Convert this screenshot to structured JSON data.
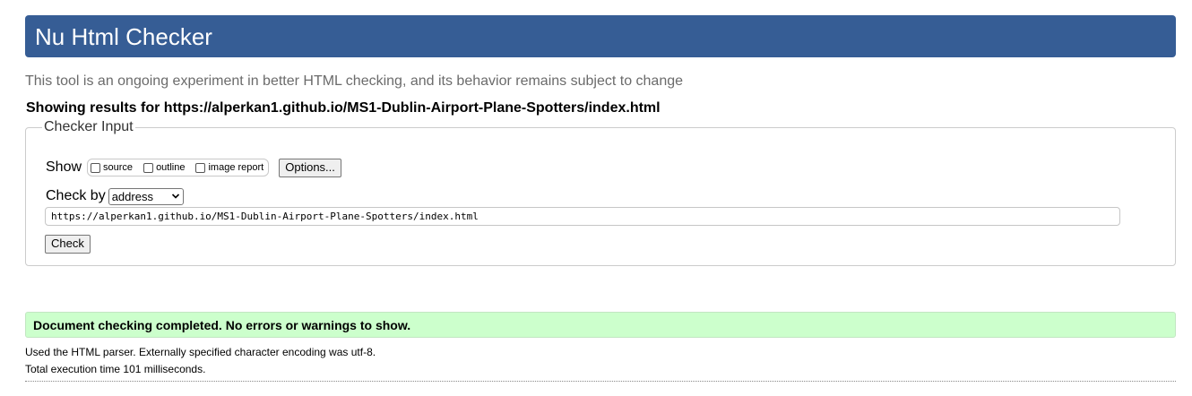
{
  "header": {
    "title": "Nu Html Checker"
  },
  "intro": "This tool is an ongoing experiment in better HTML checking, and its behavior remains subject to change",
  "results_for": "Showing results for https://alperkan1.github.io/MS1-Dublin-Airport-Plane-Spotters/index.html",
  "checker_input": {
    "legend": "Checker Input",
    "show_label": "Show",
    "show_options": [
      {
        "label": "source",
        "checked": false
      },
      {
        "label": "outline",
        "checked": false
      },
      {
        "label": "image report",
        "checked": false
      }
    ],
    "options_button": "Options...",
    "check_by_label": "Check by",
    "check_by_value": "address",
    "url_value": "https://alperkan1.github.io/MS1-Dublin-Airport-Plane-Spotters/index.html",
    "check_button": "Check"
  },
  "result": {
    "message": "Document checking completed. No errors or warnings to show.",
    "parser_note": "Used the HTML parser. Externally specified character encoding was utf-8.",
    "execution_time": "Total execution time 101 milliseconds."
  },
  "colors": {
    "header_bg": "#365d95",
    "success_bg": "#ccffcc"
  }
}
